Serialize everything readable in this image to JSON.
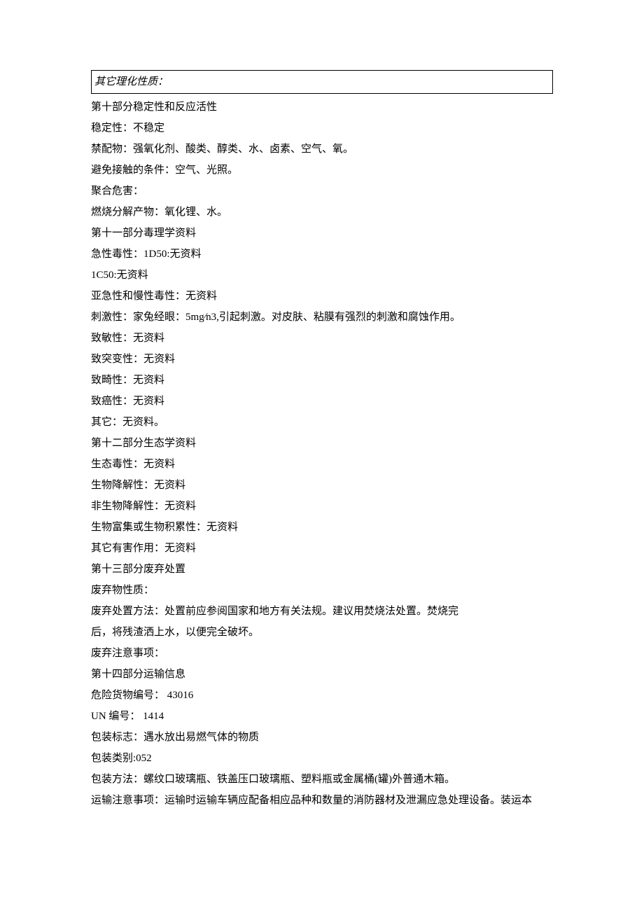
{
  "box": "其它理化性质：",
  "lines": [
    "第十部分稳定性和反应活性",
    "稳定性：不稳定",
    "禁配物：强氧化剂、酸类、醇类、水、卤素、空气、氧。",
    "避免接触的条件：空气、光照。",
    "聚合危害：",
    "燃烧分解产物：氧化锂、水。",
    "第十一部分毒理学资料",
    "急性毒性：1D50:无资料",
    "1C50:无资料",
    "亚急性和慢性毒性：无资料",
    "刺激性：家兔经眼：5mg∕n3,引起刺激。对皮肤、粘膜有强烈的刺激和腐蚀作用。",
    "致敏性：无资料",
    "致突变性：无资料",
    "致畸性：无资料",
    "致癌性：无资料",
    "其它：无资料。",
    "第十二部分生态学资料",
    "生态毒性：无资料",
    "生物降解性：无资料",
    "非生物降解性：无资料",
    "生物富集或生物积累性：无资料",
    "其它有害作用：无资料",
    "第十三部分废弃处置",
    "废弃物性质：",
    "废弃处置方法：处置前应参阅国家和地方有关法规。建议用焚烧法处置。焚烧完",
    "后，将残渣洒上水，以便完全破坏。",
    "废弃注意事项：",
    "第十四部分运输信息",
    "危险货物编号： 43016",
    "UN 编号： 1414",
    "包装标志：遇水放出易燃气体的物质",
    "包装类别:052",
    "包装方法：螺纹口玻璃瓶、铁盖压口玻璃瓶、塑料瓶或金属桶(罐)外普通木箱。",
    "运输注意事项：运输时运输车辆应配备相应品种和数量的消防器材及泄漏应急处理设备。装运本"
  ]
}
